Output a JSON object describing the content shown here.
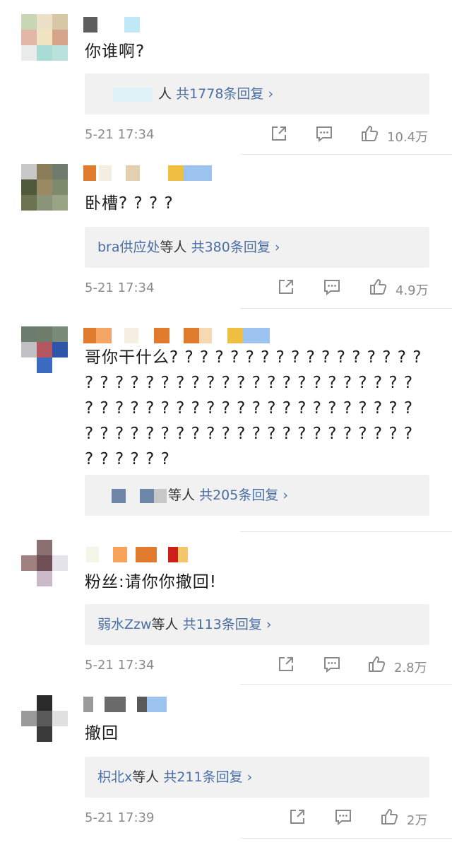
{
  "comments": [
    {
      "text": "你谁啊?",
      "reply_lead": "",
      "reply_tail": "人",
      "reply_count": "共1778条回复",
      "chevron": "›",
      "time": "5-21 17:34",
      "likes": "10.4万"
    },
    {
      "text": "卧槽? ? ? ?",
      "reply_lead": "bra供应处",
      "reply_tail": "等人",
      "reply_count": "共380条回复",
      "chevron": "›",
      "time": "5-21 17:34",
      "likes": "4.9万"
    },
    {
      "text": "哥你干什么? ? ? ? ? ? ? ? ? ? ? ? ? ? ? ? ? ? ? ? ? ? ? ? ? ? ? ? ? ? ? ? ? ? ? ? ? ? ? ? ? ? ? ? ? ? ? ? ? ? ? ? ? ? ? ? ? ? ? ? ? ? ? ? ? ? ? ? ? ? ? ? ? ? ? ? ? ? ? ? ? ? ? ? ? ? ? ? ?",
      "reply_lead": "",
      "reply_tail": "等人",
      "reply_count": "共205条回复",
      "chevron": "›",
      "time": "",
      "likes": ""
    },
    {
      "text": "粉丝:请你你撤回!",
      "reply_lead": "弱水Zzw",
      "reply_tail": "等人",
      "reply_count": "共113条回复",
      "chevron": "›",
      "time": "5-21 17:34",
      "likes": "2.8万"
    },
    {
      "text": "撤回",
      "reply_lead": "枳北x",
      "reply_tail": "等人",
      "reply_count": "共211条回复",
      "chevron": "›",
      "time": "5-21 17:39",
      "likes": "2万"
    }
  ],
  "icons": {
    "share": "share-icon",
    "comment": "comment-icon",
    "like": "thumbs-up-icon"
  },
  "colors": {
    "link": "#4a6ea3",
    "reply_bg": "#f1f1f1",
    "meta_text": "#8a8a8a"
  }
}
